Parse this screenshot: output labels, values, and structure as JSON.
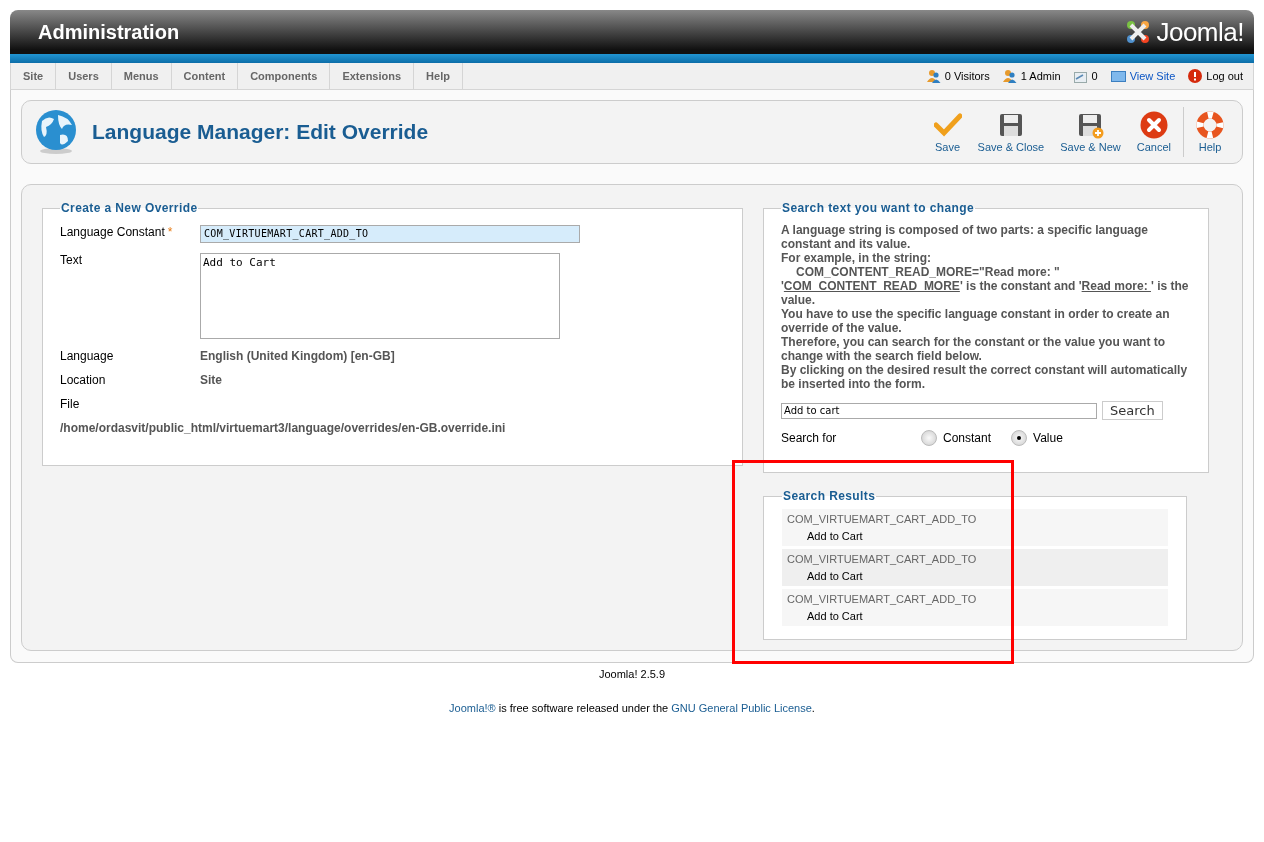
{
  "header": {
    "title": "Administration",
    "logo_text": "Joomla!"
  },
  "menu": [
    "Site",
    "Users",
    "Menus",
    "Content",
    "Components",
    "Extensions",
    "Help"
  ],
  "status": [
    {
      "kind": "users",
      "text": "0 Visitors"
    },
    {
      "kind": "users",
      "text": "1 Admin"
    },
    {
      "kind": "mail",
      "text": "0"
    },
    {
      "kind": "link",
      "text": "View Site"
    },
    {
      "kind": "logout",
      "text": "Log out"
    }
  ],
  "toolbar": {
    "title": "Language Manager: Edit Override",
    "buttons": [
      {
        "kind": "save",
        "label": "Save"
      },
      {
        "kind": "save-close",
        "label": "Save & Close"
      },
      {
        "kind": "save-new",
        "label": "Save & New"
      },
      {
        "kind": "cancel",
        "label": "Cancel"
      },
      {
        "kind": "help",
        "label": "Help"
      }
    ]
  },
  "override_form": {
    "legend": "Create a New Override",
    "fields": [
      {
        "kind": "input",
        "label": "Language Constant",
        "required_mark": "*",
        "value": "COM_VIRTUEMART_CART_ADD_TO"
      },
      {
        "kind": "textarea",
        "label": "Text",
        "value": "Add to Cart"
      },
      {
        "kind": "static",
        "label": "Language",
        "value": "English (United Kingdom) [en-GB]"
      },
      {
        "kind": "static",
        "label": "Location",
        "value": "Site"
      },
      {
        "kind": "block",
        "label": "File",
        "value": "/home/ordasvit/public_html/virtuemart3/language/overrides/en-GB.override.ini"
      }
    ]
  },
  "search_panel": {
    "legend": "Search text you want to change",
    "help": [
      {
        "indent": false,
        "parts": [
          {
            "text": "A language string is composed of two parts: a specific language constant and its value.",
            "underline": false
          }
        ]
      },
      {
        "indent": false,
        "parts": [
          {
            "text": "For example, in the string:",
            "underline": false
          }
        ]
      },
      {
        "indent": true,
        "parts": [
          {
            "text": "COM_CONTENT_READ_MORE=\"Read more: \"",
            "underline": false
          }
        ]
      },
      {
        "indent": false,
        "parts": [
          {
            "text": "'",
            "underline": false
          },
          {
            "text": "COM_CONTENT_READ_MORE",
            "underline": true
          },
          {
            "text": "' is the constant and '",
            "underline": false
          },
          {
            "text": "Read more: ",
            "underline": true
          },
          {
            "text": "' is the value.",
            "underline": false
          }
        ]
      },
      {
        "indent": false,
        "parts": [
          {
            "text": "You have to use the specific language constant in order to create an override of the value.",
            "underline": false
          }
        ]
      },
      {
        "indent": false,
        "parts": [
          {
            "text": "Therefore, you can search for the constant or the value you want to change with the search field below.",
            "underline": false
          }
        ]
      },
      {
        "indent": false,
        "parts": [
          {
            "text": "By clicking on the desired result the correct constant will automatically be inserted into the form.",
            "underline": false
          }
        ]
      }
    ],
    "search_value": "Add to cart",
    "search_button": "Search",
    "search_for_label": "Search for",
    "options": [
      {
        "label": "Constant",
        "selected": false
      },
      {
        "label": "Value",
        "selected": true
      }
    ]
  },
  "results": {
    "legend": "Search Results",
    "items": [
      {
        "constant": "COM_VIRTUEMART_CART_ADD_TO",
        "value": "Add to Cart"
      },
      {
        "constant": "COM_VIRTUEMART_CART_ADD_TO",
        "value": "Add to Cart"
      },
      {
        "constant": "COM_VIRTUEMART_CART_ADD_TO",
        "value": "Add to Cart"
      }
    ]
  },
  "footer": {
    "version": "Joomla! 2.5.9",
    "license": [
      {
        "text": "Joomla!®",
        "link": true
      },
      {
        "text": " is free software released under the ",
        "link": false
      },
      {
        "text": "GNU General Public License",
        "link": true
      },
      {
        "text": ".",
        "link": false
      }
    ]
  },
  "annotations": [
    {
      "kind": "rectangle"
    }
  ]
}
